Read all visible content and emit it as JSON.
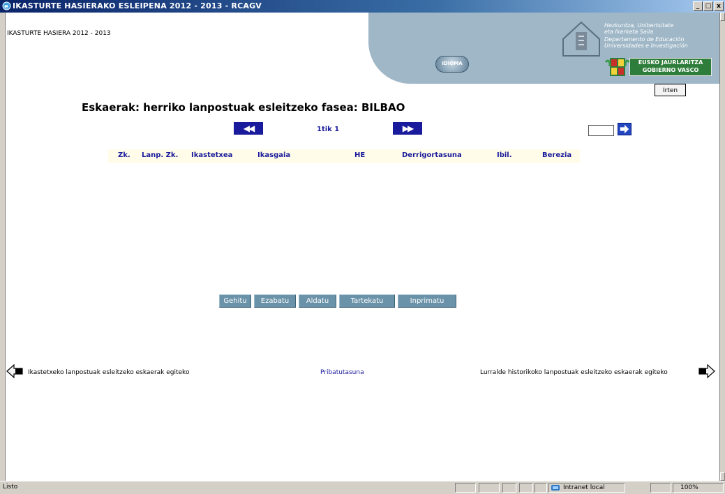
{
  "window": {
    "title": "IKASTURTE HASIERAKO ESLEIPENA 2012 - 2013 - RCAGV",
    "controls": [
      "_",
      "□",
      "x"
    ]
  },
  "header": {
    "year_text": "IKASTURTE HASIERA 2012 - 2013",
    "idioma_label": "IDIOMA"
  },
  "banner": {
    "dept_lines": [
      "Hezkuntza, Unibertsitate",
      "eta Ikerketa Saila",
      "Departamento de Educación",
      "Universidades e Investigación"
    ],
    "gov_line1": "EUSKO JAURLARITZA",
    "gov_line2": "GOBIERNO VASCO"
  },
  "irten_label": "Irten",
  "page_heading": "Eskaerak: herriko lanpostuak esleitzeko fasea: BILBAO",
  "pagination": {
    "prev": "◀◀",
    "next": "▶▶",
    "page_info": "1tik 1"
  },
  "table": {
    "headers": [
      "Zk.",
      "Lanp. Zk.",
      "Ikastetxea",
      "Ikasgaia",
      "HE",
      "Derrigortasuna",
      "Ibil.",
      "Berezia"
    ]
  },
  "actions": [
    "Gehitu",
    "Ezabatu",
    "Aldatu",
    "Tartekatu",
    "Inprimatu"
  ],
  "footer": {
    "left_link": "Ikastetxeko lanpostuak esleitzeko eskaerak egiteko",
    "center_link": "Pribatutasuna",
    "right_link": "Lurralde historikoko lanpostuak esleitzeko eskaerak egiteko"
  },
  "statusbar": {
    "status": "Listo",
    "zone": "Intranet local",
    "zoom": "100%"
  }
}
